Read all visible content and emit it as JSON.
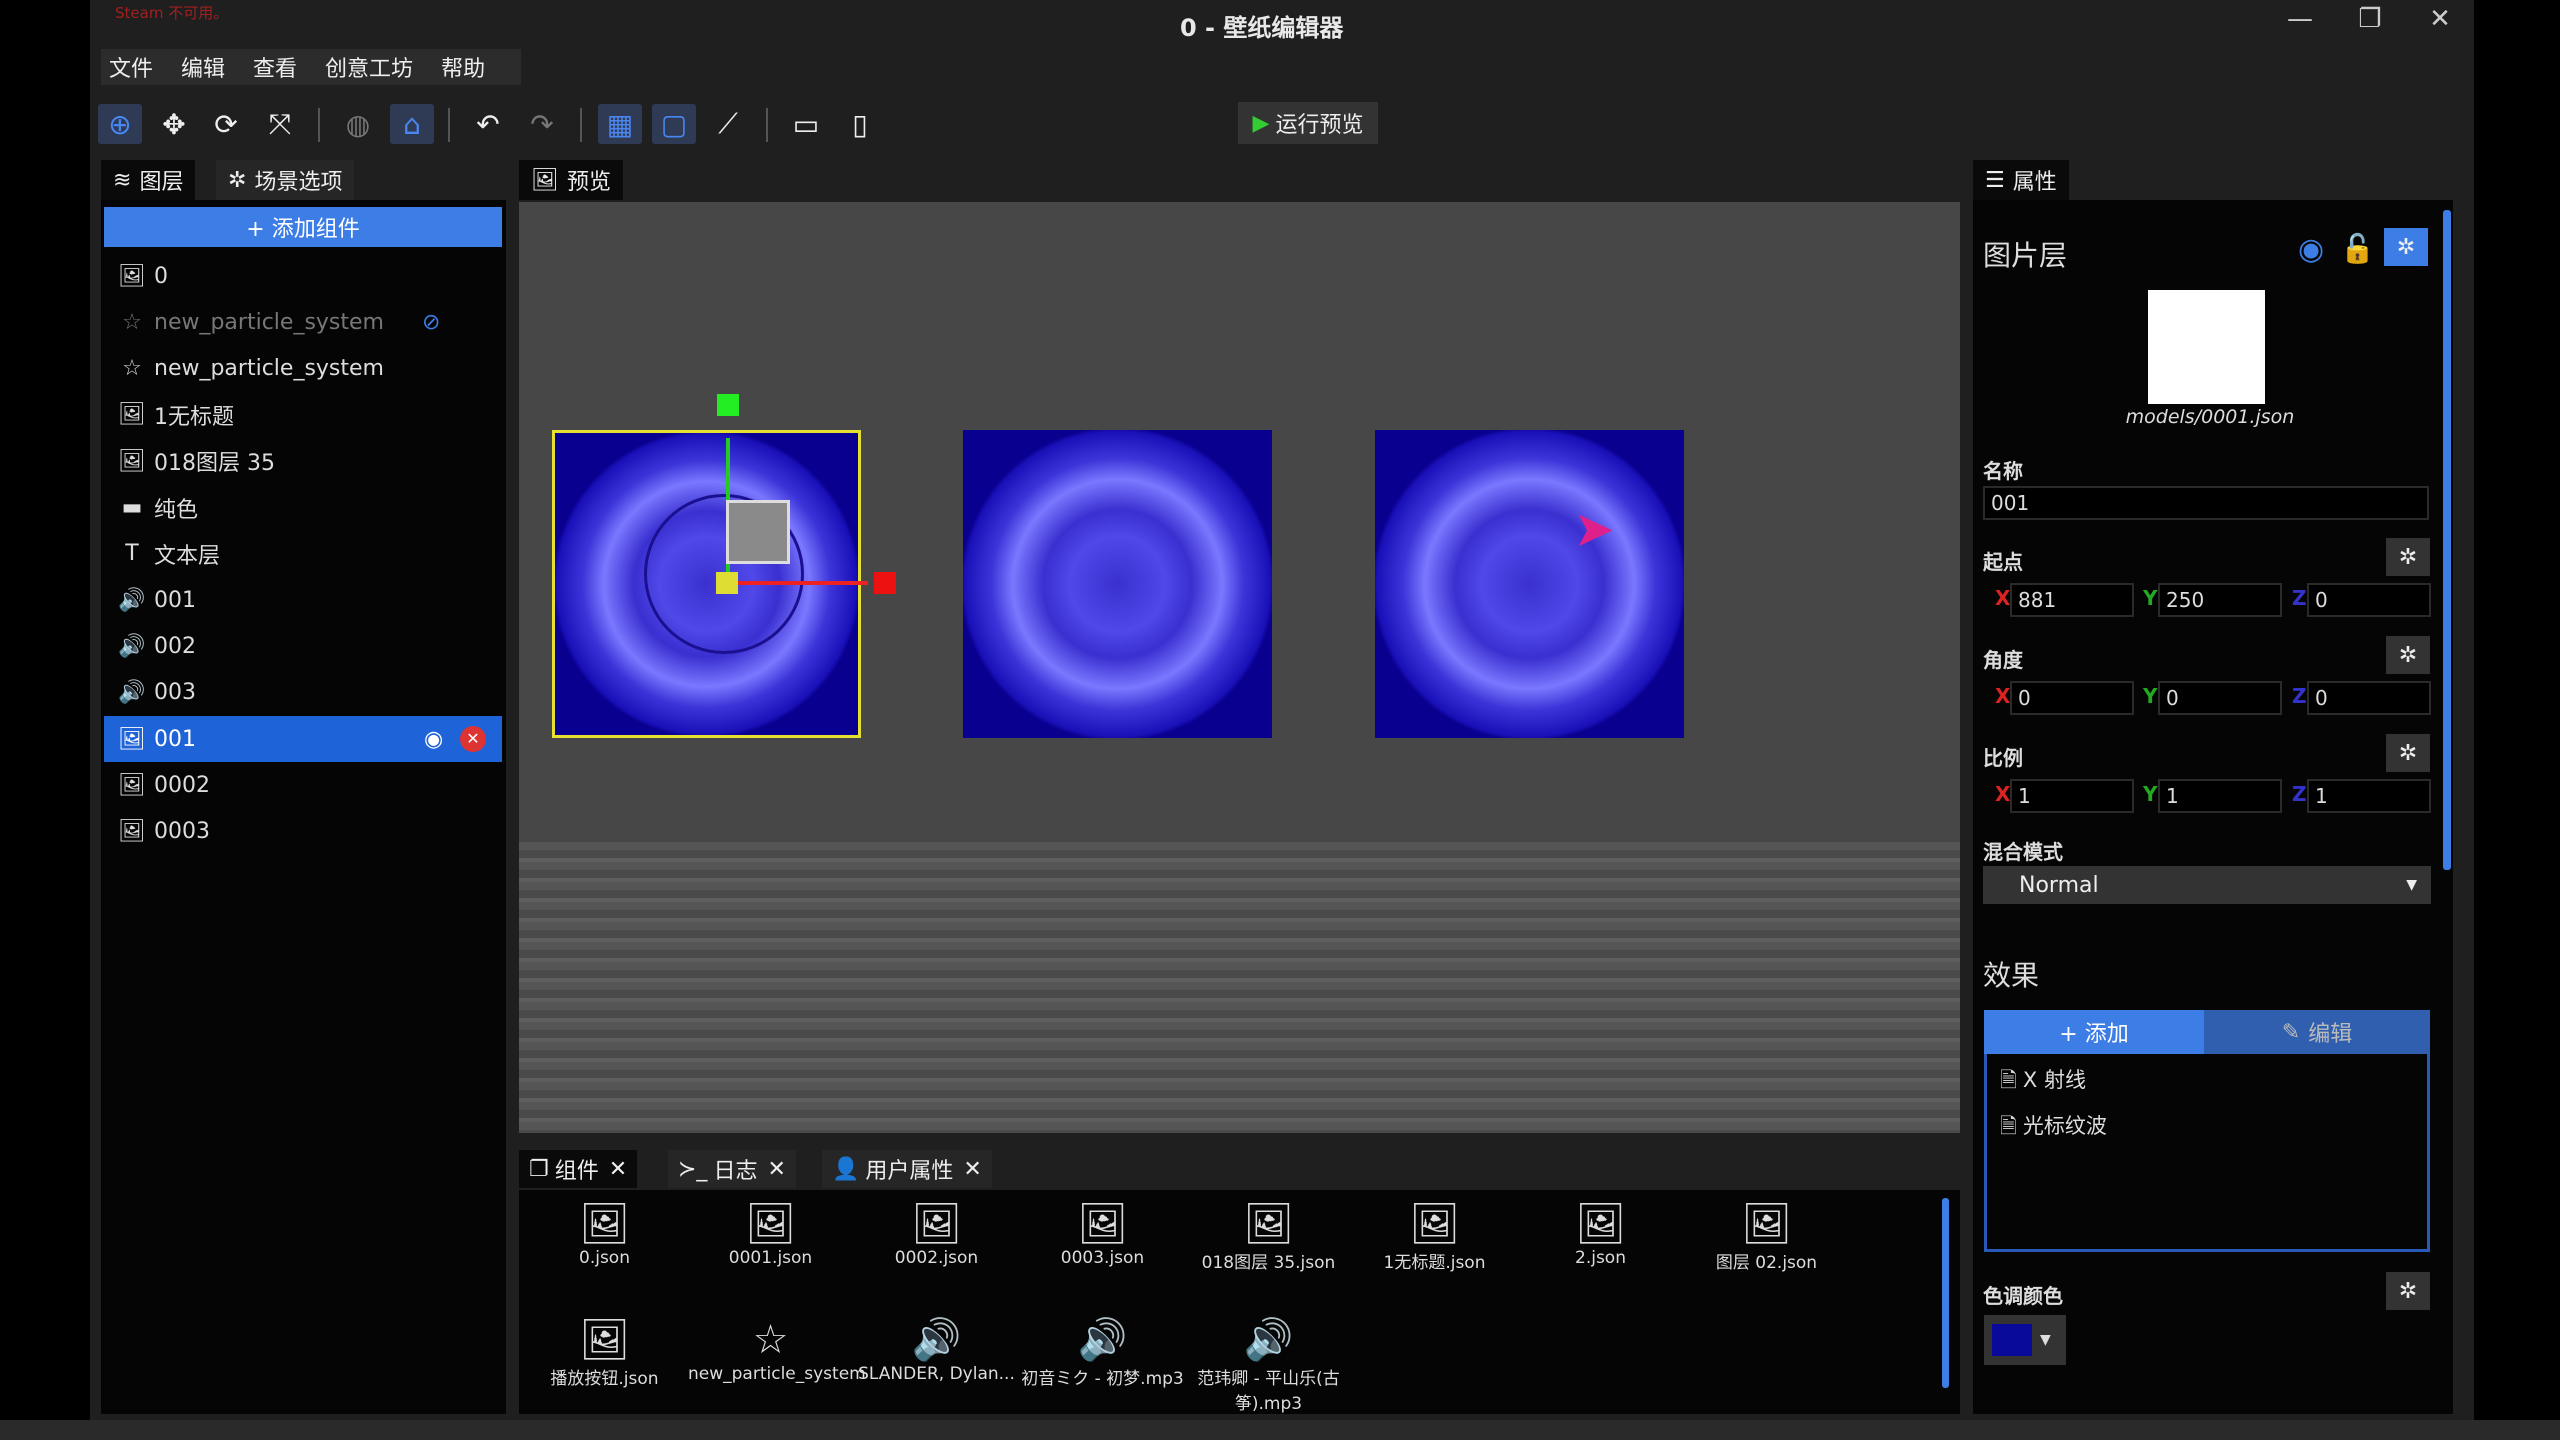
{
  "window": {
    "title": "0 - 壁纸编辑器",
    "steam_notice": "Steam 不可用。"
  },
  "menu": [
    "文件",
    "编辑",
    "查看",
    "创意工坊",
    "帮助"
  ],
  "toolbar": {
    "run_preview": "运行预览",
    "icons": [
      "select-icon",
      "move-icon",
      "rotate-icon",
      "scale-icon",
      "globe-icon",
      "home-icon",
      "undo-icon",
      "redo-icon",
      "grid-icon",
      "frame-icon",
      "graph-icon",
      "desktop-icon",
      "mobile-icon"
    ]
  },
  "left": {
    "tabs": [
      "图层",
      "场景选项"
    ],
    "add_component": "+ 添加组件",
    "layers": [
      {
        "icon": "image",
        "label": "0"
      },
      {
        "icon": "star",
        "label": "new_particle_system",
        "hidden": true
      },
      {
        "icon": "star",
        "label": "new_particle_system"
      },
      {
        "icon": "image",
        "label": "1无标题"
      },
      {
        "icon": "image",
        "label": "018图层 35"
      },
      {
        "icon": "solid",
        "label": "纯色"
      },
      {
        "icon": "text",
        "label": "文本层"
      },
      {
        "icon": "sound",
        "label": "001"
      },
      {
        "icon": "sound",
        "label": "002"
      },
      {
        "icon": "sound",
        "label": "003"
      },
      {
        "icon": "image",
        "label": "001",
        "selected": true
      },
      {
        "icon": "image",
        "label": "0002"
      },
      {
        "icon": "image",
        "label": "0003"
      }
    ]
  },
  "preview": {
    "tab": "预览"
  },
  "bottom": {
    "tabs": [
      "组件",
      "日志",
      "用户属性"
    ],
    "assets": [
      {
        "icon": "image",
        "label": "0.json"
      },
      {
        "icon": "image",
        "label": "0001.json"
      },
      {
        "icon": "image",
        "label": "0002.json"
      },
      {
        "icon": "image",
        "label": "0003.json"
      },
      {
        "icon": "image",
        "label": "018图层 35.json"
      },
      {
        "icon": "image",
        "label": "1无标题.json"
      },
      {
        "icon": "image",
        "label": "2.json"
      },
      {
        "icon": "image",
        "label": "图层 02.json"
      },
      {
        "icon": "image",
        "label": "播放按钮.json"
      },
      {
        "icon": "star",
        "label": "new_particle_system"
      },
      {
        "icon": "sound",
        "label": "SLANDER, Dylan..."
      },
      {
        "icon": "sound",
        "label": "初音ミク - 初梦.mp3"
      },
      {
        "icon": "sound",
        "label": "范玮卿 - 平山乐(古筝).mp3"
      }
    ]
  },
  "props": {
    "tab": "属性",
    "heading": "图片层",
    "model": "models/0001.json",
    "name_label": "名称",
    "name": "001",
    "origin_label": "起点",
    "origin": {
      "x": "881",
      "y": "250",
      "z": "0"
    },
    "angle_label": "角度",
    "angle": {
      "x": "0",
      "y": "0",
      "z": "0"
    },
    "scale_label": "比例",
    "scale": {
      "x": "1",
      "y": "1",
      "z": "1"
    },
    "blend_label": "混合模式",
    "blend": "Normal",
    "effects_label": "效果",
    "add": "+ 添加",
    "edit": "编辑",
    "effects": [
      "X 射线",
      "光标纹波"
    ],
    "tint_label": "色调颜色",
    "tint_color": "#0a0a9a"
  },
  "colors": {
    "accent": "#3d7de6",
    "selection": "#1f63d8"
  }
}
